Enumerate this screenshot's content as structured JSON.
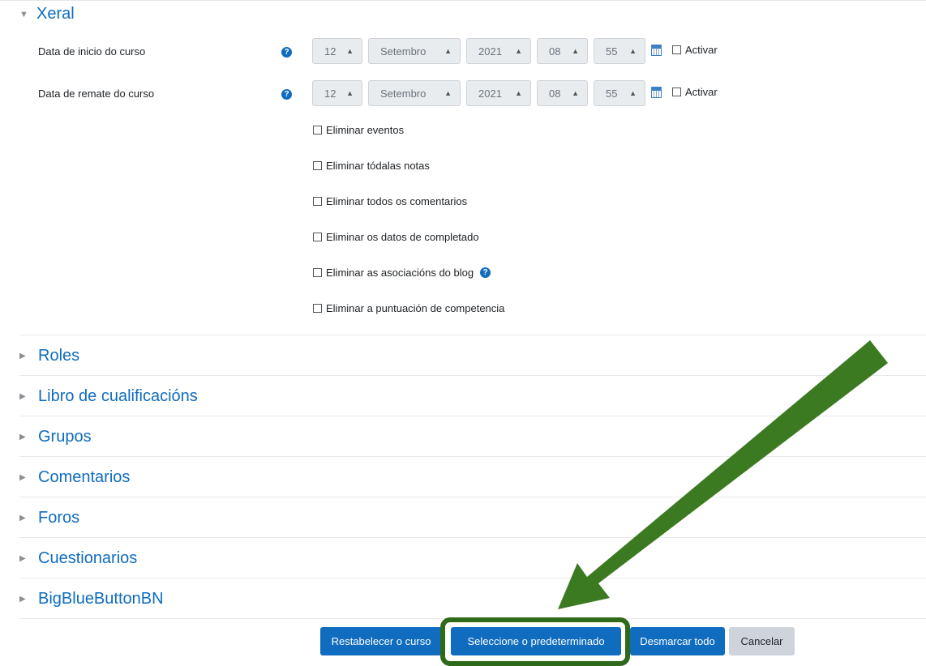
{
  "sections": {
    "xeral": {
      "title": "Xeral"
    },
    "collapsed": [
      {
        "title": "Roles"
      },
      {
        "title": "Libro de cualificacións"
      },
      {
        "title": "Grupos"
      },
      {
        "title": "Comentarios"
      },
      {
        "title": "Foros"
      },
      {
        "title": "Cuestionarios"
      },
      {
        "title": "BigBlueButtonBN"
      }
    ]
  },
  "start_date": {
    "label": "Data de inicio do curso",
    "day": "12",
    "month": "Setembro",
    "year": "2021",
    "hour": "08",
    "minute": "55",
    "enable_label": "Activar"
  },
  "end_date": {
    "label": "Data de remate do curso",
    "day": "12",
    "month": "Setembro",
    "year": "2021",
    "hour": "08",
    "minute": "55",
    "enable_label": "Activar"
  },
  "options": [
    {
      "label": "Eliminar eventos"
    },
    {
      "label": "Eliminar tódalas notas"
    },
    {
      "label": "Eliminar todos os comentarios"
    },
    {
      "label": "Eliminar os datos de completado"
    },
    {
      "label": "Eliminar as asociacións do blog"
    },
    {
      "label": "Eliminar a puntuación de competencia"
    }
  ],
  "buttons": {
    "reset": "Restabelecer o curso",
    "select_default": "Seleccione o predeterminado",
    "deselect_all": "Desmarcar todo",
    "cancel": "Cancelar"
  },
  "colors": {
    "link": "#0f6cbf",
    "primary_button": "#0f6cbf",
    "annotation": "#3c7a22"
  },
  "icons": {
    "help": "question-circle-icon",
    "calendar": "calendar-icon",
    "expanded": "caret-down-icon",
    "collapsed": "caret-right-icon"
  }
}
